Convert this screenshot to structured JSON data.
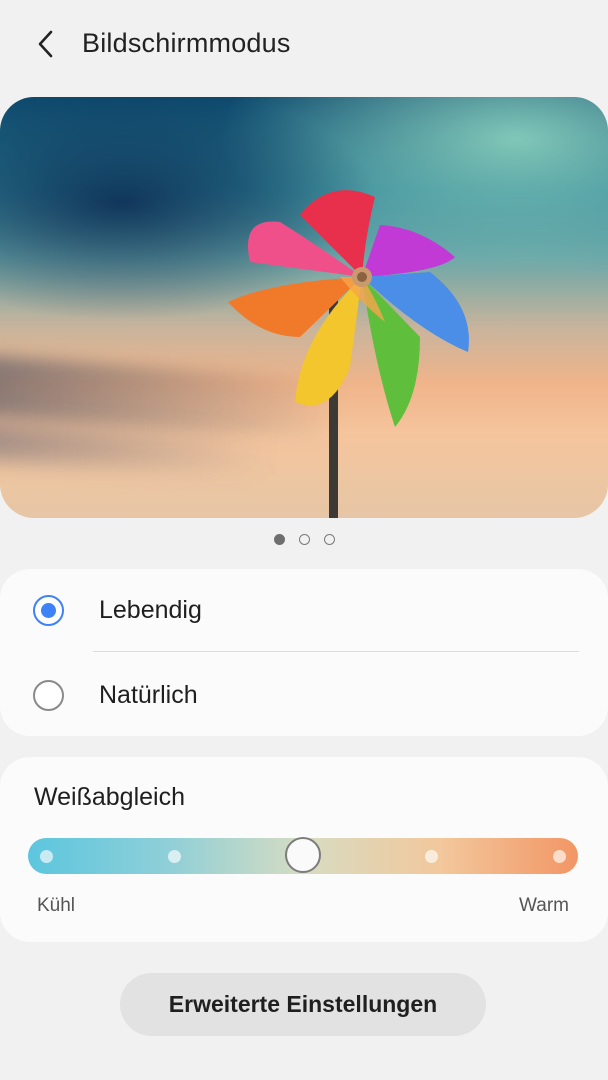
{
  "header": {
    "title": "Bildschirmmodus",
    "back_icon": "chevron-left-icon"
  },
  "preview": {
    "image": "pinwheel-photo",
    "pages": 3,
    "active_page": 1
  },
  "modes": {
    "options": [
      {
        "label": "Lebendig",
        "selected": true
      },
      {
        "label": "Natürlich",
        "selected": false
      }
    ]
  },
  "white_balance": {
    "title": "Weißabgleich",
    "min_label": "Kühl",
    "max_label": "Warm",
    "steps": 5,
    "value_step": 3
  },
  "advanced": {
    "label": "Erweiterte Einstellungen"
  },
  "colors": {
    "accent": "#3e82f7",
    "background": "#f1f1f1",
    "card": "#fbfbfb"
  }
}
